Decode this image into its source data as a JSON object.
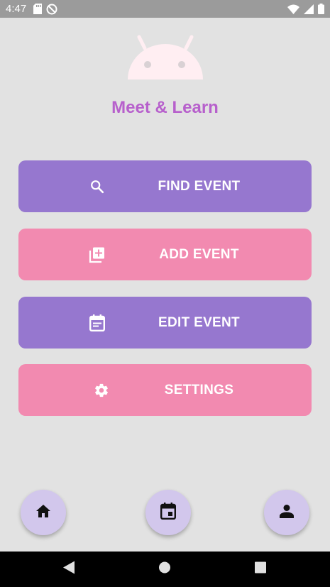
{
  "status_bar": {
    "time": "4:47",
    "icons": [
      "sd-card-icon",
      "no-sync-icon",
      "wifi-icon",
      "signal-icon",
      "battery-icon"
    ]
  },
  "app": {
    "title": "Meet & Learn",
    "logo_icon": "android-logo-icon",
    "colors": {
      "background": "#e2e2e2",
      "title": "#b760cc",
      "purple_button": "#9677cf",
      "pink_button": "#f28ab0",
      "round_button": "#d2c7ec",
      "logo": "#ffeef2"
    }
  },
  "actions": {
    "find_event": {
      "label": "FIND EVENT",
      "icon": "search-icon"
    },
    "add_event": {
      "label": "ADD EVENT",
      "icon": "add-to-library-icon"
    },
    "edit_event": {
      "label": "EDIT EVENT",
      "icon": "event-note-icon"
    },
    "settings": {
      "label": "SETTINGS",
      "icon": "gear-icon"
    }
  },
  "bottom_nav": {
    "home": {
      "icon": "home-icon"
    },
    "calendar": {
      "icon": "calendar-icon"
    },
    "profile": {
      "icon": "person-icon"
    }
  },
  "system_nav": {
    "back": {
      "icon": "back-triangle-icon"
    },
    "home": {
      "icon": "home-circle-icon"
    },
    "recents": {
      "icon": "recents-square-icon"
    }
  }
}
